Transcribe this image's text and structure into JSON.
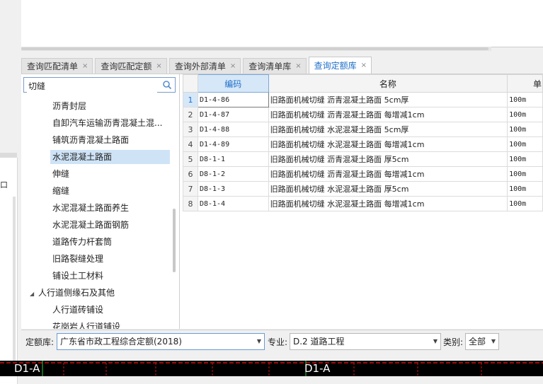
{
  "tabs": [
    {
      "label": "查询匹配清单",
      "close": "×"
    },
    {
      "label": "查询匹配定额",
      "close": "×"
    },
    {
      "label": "查询外部清单",
      "close": "×"
    },
    {
      "label": "查询清单库",
      "close": "×"
    },
    {
      "label": "查询定额库",
      "close": "×"
    }
  ],
  "search": {
    "value": "切缝"
  },
  "tree": [
    {
      "label": "沥青封层"
    },
    {
      "label": "自卸汽车运输沥青混凝土混..."
    },
    {
      "label": "铺筑沥青混凝土路面"
    },
    {
      "label": "水泥混凝土路面"
    },
    {
      "label": "伸缝"
    },
    {
      "label": "缩缝"
    },
    {
      "label": "水泥混凝土路面养生"
    },
    {
      "label": "水泥混凝土路面钢筋"
    },
    {
      "label": "道路传力杆套筒"
    },
    {
      "label": "旧路裂缝处理"
    },
    {
      "label": "铺设土工材料"
    },
    {
      "label": "人行道侧缘石及其他"
    },
    {
      "label": "人行道砖铺设"
    },
    {
      "label": "花岗岩人行道铺设"
    }
  ],
  "table": {
    "headers": {
      "code": "编码",
      "name": "名称",
      "unit": "单"
    },
    "rows": [
      {
        "num": "1",
        "code": "D1-4-86",
        "name": "旧路面机械切缝 沥青混凝土路面 5cm厚",
        "unit": "100m"
      },
      {
        "num": "2",
        "code": "D1-4-87",
        "name": "旧路面机械切缝 沥青混凝土路面 每增减1cm",
        "unit": "100m"
      },
      {
        "num": "3",
        "code": "D1-4-88",
        "name": "旧路面机械切缝 水泥混凝土路面 5cm厚",
        "unit": "100m"
      },
      {
        "num": "4",
        "code": "D1-4-89",
        "name": "旧路面机械切缝 水泥混凝土路面 每增减1cm",
        "unit": "100m"
      },
      {
        "num": "5",
        "code": "D8-1-1",
        "name": "旧路面机械切缝 沥青混凝土路面 厚5cm",
        "unit": "100m"
      },
      {
        "num": "6",
        "code": "D8-1-2",
        "name": "旧路面机械切缝 沥青混凝土路面 每增减1cm",
        "unit": "100m"
      },
      {
        "num": "7",
        "code": "D8-1-3",
        "name": "旧路面机械切缝 水泥混凝土路面 厚5cm",
        "unit": "100m"
      },
      {
        "num": "8",
        "code": "D8-1-4",
        "name": "旧路面机械切缝 水泥混凝土路面 每增减1cm",
        "unit": "100m"
      }
    ]
  },
  "filters": {
    "library_label": "定额库:",
    "library_value": "广东省市政工程综合定额(2018)",
    "major_label": "专业:",
    "major_value": "D.2 道路工程",
    "category_label": "类别:",
    "category_value": "全部"
  },
  "cad": {
    "label_left": "D1-A",
    "label_right": "D1-A"
  },
  "left_strip_label": "口",
  "colors": {
    "accent": "#1f6fc9",
    "selected_row": "#cfe3f7",
    "cad_red": "#d01010"
  }
}
